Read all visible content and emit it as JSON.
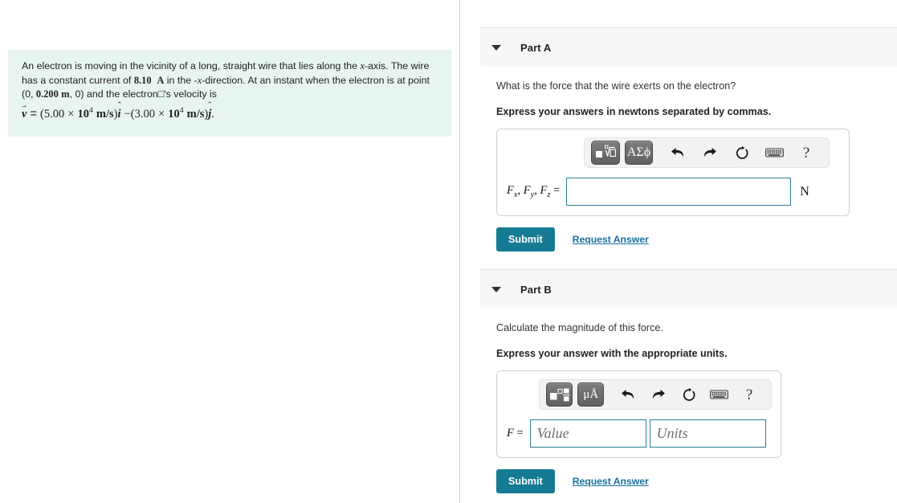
{
  "problem": {
    "line1": "An electron is moving in the vicinity of a long, straight wire that lies along the ",
    "axis_sym": "x",
    "line1b": "-axis. The wire has a constant current of ",
    "current": "8.10",
    "current_unit": "A",
    "line1c": " in the -",
    "dir_sym": "x",
    "line1d": "-direction. At an instant when the electron is at point (0, ",
    "position": "0.200",
    "position_unit": "m",
    "line1e": ", 0) and the electron□'s velocity is",
    "velocity": {
      "symbol": "v",
      "equals": "=",
      "term1_open": "(",
      "term1_coeff": "5.00",
      "times": "×",
      "term1_base": "10",
      "term1_exp": "4",
      "term1_unit": "m/s",
      "term1_close": ")",
      "term1_hat": "i",
      "minus": "−",
      "term2_open": "(",
      "term2_coeff": "3.00",
      "term2_base": "10",
      "term2_exp": "4",
      "term2_unit": "m/s",
      "term2_close": ")",
      "term2_hat": "j",
      "period": "."
    }
  },
  "parts": [
    {
      "id": "a",
      "title": "Part A",
      "question": "What is the force that the wire exerts on the electron?",
      "instruction": "Express your answers in newtons separated by commas.",
      "toolbar": {
        "template_button": "square-root-template-icon",
        "greek_button": "ΑΣϕ",
        "undo": "undo-icon",
        "redo": "redo-icon",
        "reset": "reset-icon",
        "keyboard": "keyboard-icon",
        "help": "?"
      },
      "answer": {
        "label_f": "F",
        "sub_x": "x",
        "sub_y": "y",
        "sub_z": "z",
        "comma": ",",
        "equals": "=",
        "value": "",
        "placeholder": "",
        "unit": "N"
      },
      "submit_label": "Submit",
      "request_label": "Request Answer"
    },
    {
      "id": "b",
      "title": "Part B",
      "question": "Calculate the magnitude of this force.",
      "instruction": "Express your answer with the appropriate units.",
      "toolbar": {
        "template_button": "fraction-template-icon",
        "units_button": "μÅ",
        "undo": "undo-icon",
        "redo": "redo-icon",
        "reset": "reset-icon",
        "keyboard": "keyboard-icon",
        "help": "?"
      },
      "answer": {
        "label_f": "F",
        "equals": "=",
        "value": "",
        "value_placeholder": "Value",
        "units_value": "",
        "units_placeholder": "Units"
      },
      "submit_label": "Submit",
      "request_label": "Request Answer"
    }
  ],
  "colors": {
    "problem_bg": "#e8f4f1",
    "submit_bg": "#157a94",
    "link": "#1570a0",
    "input_border": "#2b7e95",
    "header_bg": "#f7f7f7"
  }
}
